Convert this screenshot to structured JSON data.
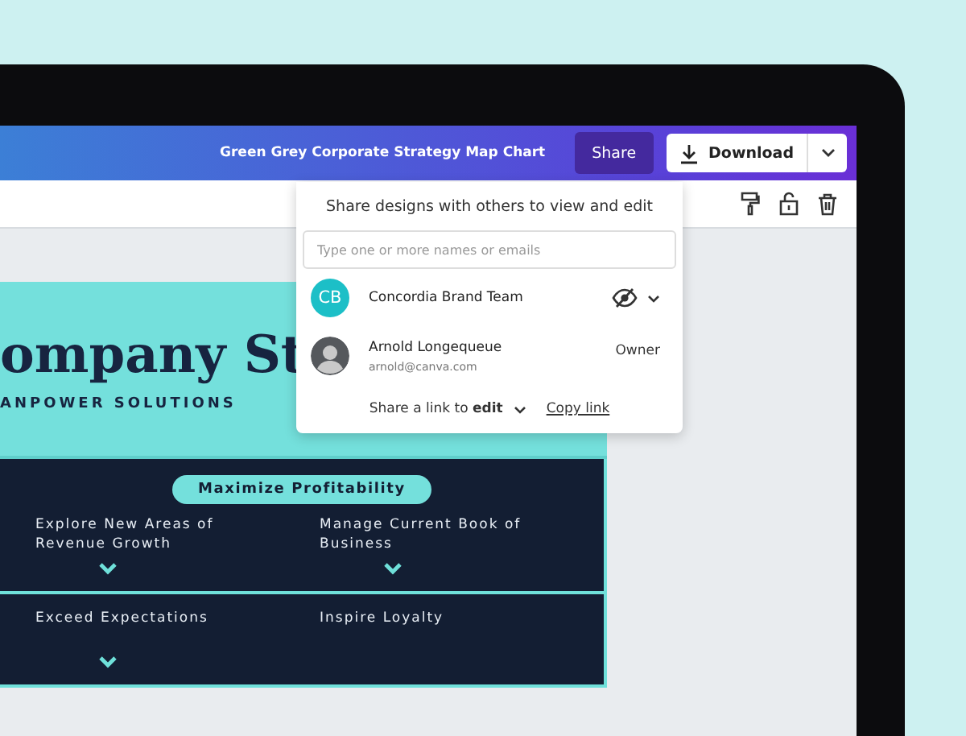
{
  "top_bar": {
    "document_title": "Green Grey Corporate Strategy Map Chart",
    "share_button": "Share",
    "download_button": "Download"
  },
  "design": {
    "title": "ompany St",
    "subtitle": "ANPOWER SOLUTIONS",
    "goal": "Maximize Profitability",
    "rows": [
      {
        "items": [
          {
            "text": "Explore New Areas of Revenue Growth",
            "expandable": true
          },
          {
            "text": "Manage Current Book of Business",
            "expandable": true
          }
        ]
      },
      {
        "items": [
          {
            "text": "Exceed Expectations",
            "expandable": true
          },
          {
            "text": "Inspire Loyalty",
            "expandable": false
          }
        ]
      }
    ]
  },
  "share_panel": {
    "heading": "Share designs with others to view and edit",
    "placeholder": "Type one or more names or emails",
    "members": [
      {
        "kind": "team",
        "initials": "CB",
        "name": "Concordia Brand Team"
      },
      {
        "kind": "person",
        "name": "Arnold Longequeue",
        "email": "arnold@canva.com",
        "role": "Owner"
      }
    ],
    "link_text": "Share a link to **edit**",
    "copy_link": "Copy link"
  }
}
